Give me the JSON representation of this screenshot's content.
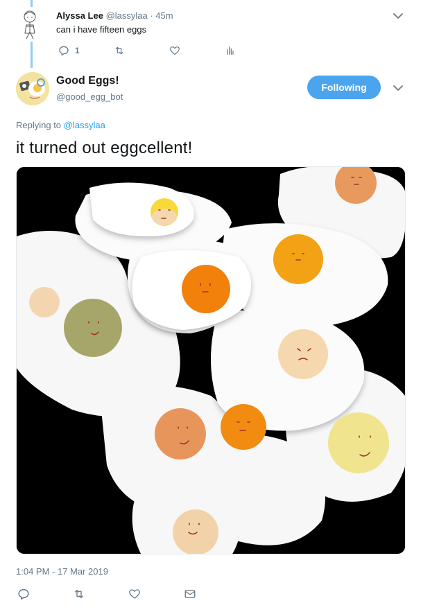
{
  "parent_tweet": {
    "display_name": "Alyssa Lee",
    "handle": "@lassylaa",
    "separator": " · ",
    "time_ago": "45m",
    "text": "can i have fifteen eggs",
    "reply_count": "1",
    "icons": [
      "reply-icon",
      "retweet-icon",
      "like-icon",
      "analytics-icon"
    ]
  },
  "main_tweet": {
    "display_name": "Good Eggs!",
    "handle": "@good_egg_bot",
    "follow_label": "Following",
    "replying_prefix": "Replying to ",
    "replying_handle": "@lassylaa",
    "text": "it turned out eggcellent!",
    "timestamp": "1:04 PM - 17 Mar 2019",
    "icons": [
      "reply-icon",
      "retweet-icon",
      "like-icon",
      "direct-message-icon"
    ]
  },
  "colors": {
    "accent": "#1da1f2",
    "follow_button": "#4ba5ee",
    "thread_line": "#8ecdf8",
    "secondary_text": "#657786"
  },
  "media": {
    "description_icon": "fried-eggs-image"
  }
}
